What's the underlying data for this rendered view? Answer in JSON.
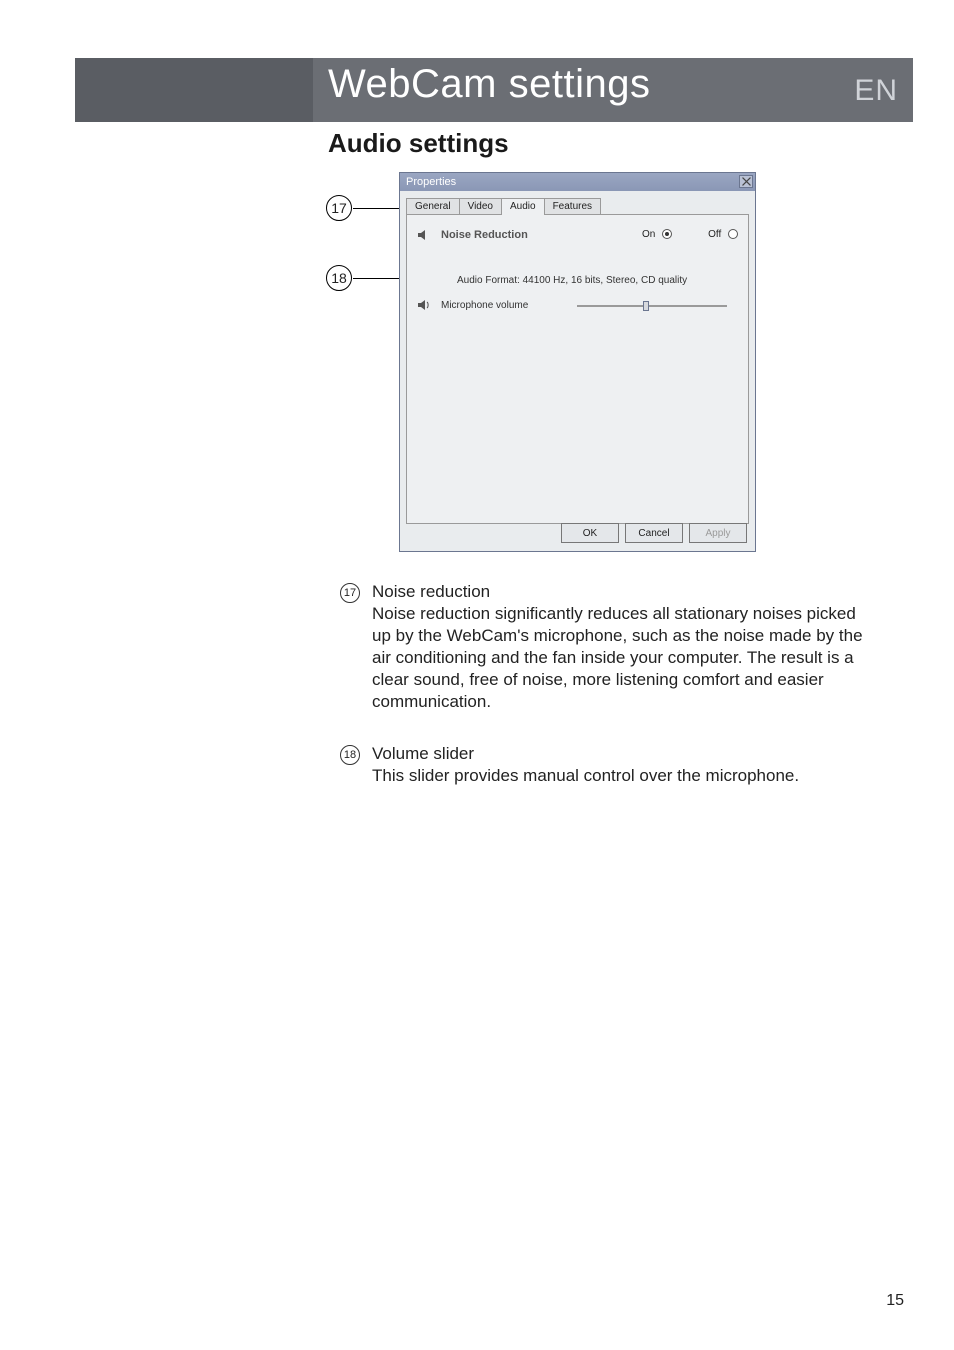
{
  "header": {
    "title": "WebCam settings",
    "lang": "EN"
  },
  "subtitle": "Audio settings",
  "window": {
    "title": "Properties",
    "tabs": {
      "general": "General",
      "video": "Video",
      "audio": "Audio",
      "features": "Features"
    },
    "noise_reduction_label": "Noise Reduction",
    "on_label": "On",
    "off_label": "Off",
    "audio_format": "Audio Format: 44100 Hz, 16 bits, Stereo, CD quality",
    "mic_volume_label": "Microphone volume",
    "buttons": {
      "ok": "OK",
      "cancel": "Cancel",
      "apply": "Apply"
    },
    "slider_pos_percent": 46
  },
  "callouts": {
    "c17": "17",
    "c18": "18"
  },
  "items": {
    "i17": {
      "num": "17",
      "title": "Noise reduction",
      "body": "Noise reduction significantly reduces all stationary noises picked up by the WebCam's microphone, such as the noise made by the air conditioning and the fan inside your computer. The result is a clear sound, free of noise, more listening comfort and easier communication."
    },
    "i18": {
      "num": "18",
      "title": "Volume slider",
      "body": "This slider provides manual control over the microphone."
    }
  },
  "page_number": "15"
}
